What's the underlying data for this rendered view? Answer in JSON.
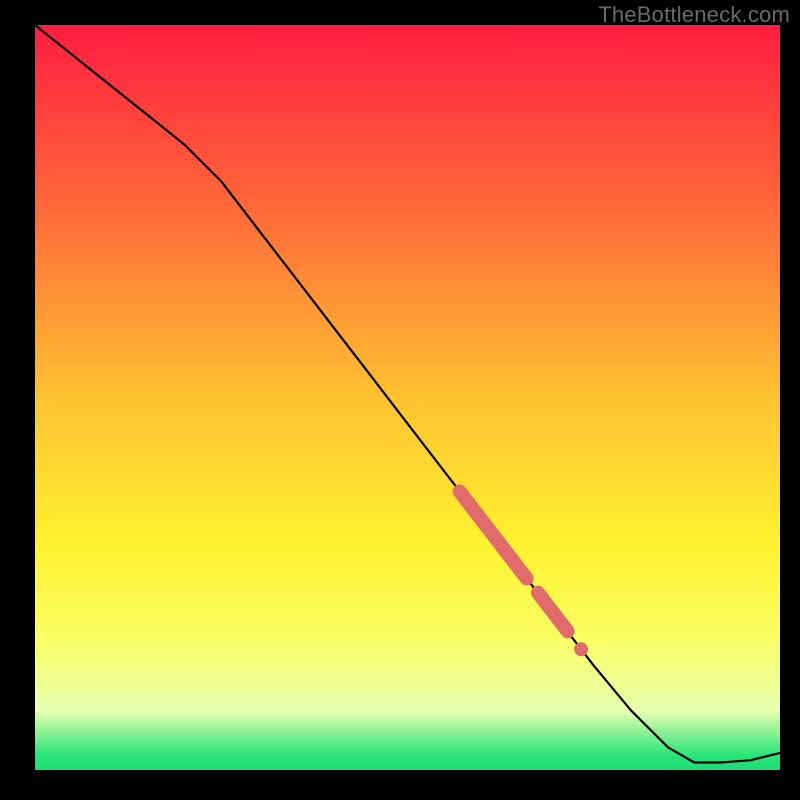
{
  "watermark": "TheBottleneck.com",
  "chart_data": {
    "type": "line",
    "title": "",
    "xlabel": "",
    "ylabel": "",
    "xlim": [
      0,
      100
    ],
    "ylim": [
      0,
      100
    ],
    "background_gradient": {
      "top_color": "#ff1d40",
      "bottom_color": "#1bdd74",
      "stops": [
        "#ff1d40",
        "#ff6a39",
        "#ffc231",
        "#fff22f",
        "#f9ff60",
        "#e9ffb0",
        "#29e57a"
      ]
    },
    "series": [
      {
        "name": "bottleneck-curve",
        "color": "#000000",
        "x": [
          0,
          5,
          10,
          15,
          20,
          25,
          30,
          35,
          40,
          45,
          50,
          55,
          60,
          65,
          70,
          75,
          80,
          85,
          88.5,
          92,
          96,
          100
        ],
        "y": [
          100,
          96,
          92,
          88,
          84,
          79,
          72.5,
          66,
          59.5,
          53,
          46.5,
          40,
          33.5,
          27,
          20.5,
          14,
          8,
          3,
          1,
          1,
          1.3,
          2.3
        ]
      },
      {
        "name": "highlight-band",
        "color": "#e16a6a",
        "segments": [
          {
            "x": [
              57,
              66
            ],
            "y": [
              37.4,
              25.7
            ]
          },
          {
            "x": [
              67.5,
              71.5
            ],
            "y": [
              23.8,
              18.6
            ]
          }
        ],
        "points": [
          {
            "x": 73.3,
            "y": 16.2
          }
        ]
      }
    ]
  }
}
